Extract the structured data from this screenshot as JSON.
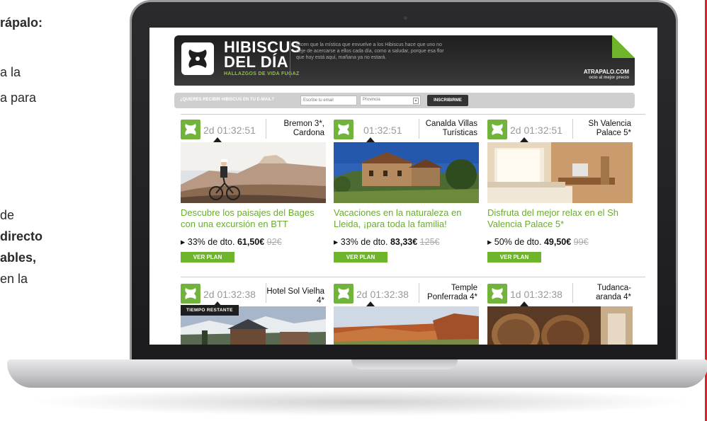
{
  "article": {
    "lines": [
      {
        "text": "rápalo:",
        "bold": true
      },
      {
        "text": "a la",
        "bold": false
      },
      {
        "text": "a para",
        "bold": false
      },
      {
        "text": "de",
        "bold": false
      },
      {
        "text": "directo",
        "bold": true
      },
      {
        "text": "ables,",
        "bold": true
      },
      {
        "text": "en la",
        "bold": false
      }
    ]
  },
  "site": {
    "logo_title_line1": "HIBISCUS",
    "logo_title_line2": "DEL DÍA",
    "logo_tagline": "HALLAZGOS DE VIDA FUGAZ",
    "description": "Dicen que la mística que envuelve a los Hibiscus hace que uno no deje de acercarse a ellos cada día, como a saludar, porque esa flor que hoy está aquí, mañana ya no estará.",
    "brand_name": "ATRAPALO.COM",
    "brand_tagline": "ocio al mejor precio"
  },
  "subscribe": {
    "label": "¿QUIERES RECIBIR HIBISCUS EN TU E-MAIL?",
    "email_placeholder": "Escribe tu email",
    "province_value": "Provincia",
    "button_label": "INSCRIBIRME"
  },
  "tooltip": "TIEMPO RESTANTE",
  "deals": [
    {
      "timer": "2d 01:32:51",
      "hotel": "Bremon 3*, Cardona",
      "title": "Descubre los paisajes del Bages con una excursión en BTT",
      "discount": "33% de dto.",
      "price": "61,50€",
      "old_price": "92€",
      "button": "VER PLAN"
    },
    {
      "timer": "01:32:51",
      "hotel": "Canalda Villas Turísticas",
      "title": "Vacaciones en la naturaleza en Lleida, ¡para toda la familia!",
      "discount": "33% de dto.",
      "price": "83,33€",
      "old_price": "125€",
      "button": "VER PLAN"
    },
    {
      "timer": "2d 01:32:51",
      "hotel": "Sh Valencia Palace 5*",
      "title": "Disfruta del mejor relax en el Sh Valencia Palace 5*",
      "discount": "50% de dto.",
      "price": "49,50€",
      "old_price": "99€",
      "button": "VER PLAN"
    },
    {
      "timer": "2d 01:32:38",
      "hotel": "Hotel Sol Vielha 4*"
    },
    {
      "timer": "2d 01:32:38",
      "hotel": "Temple Ponferrada 4*"
    },
    {
      "timer": "1d 01:32:38",
      "hotel": "Tudanca-aranda 4*"
    }
  ],
  "colors": {
    "accent_green": "#6fb52c",
    "header_dark": "#1e1e1e",
    "sidebar_red": "#d8262b"
  }
}
